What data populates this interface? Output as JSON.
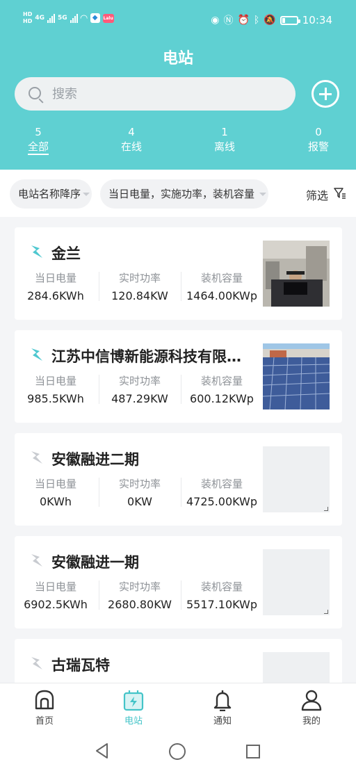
{
  "status_bar": {
    "signal_labels": [
      "HD",
      "HD",
      "4G",
      "5G"
    ],
    "app_badge": "Lalu",
    "time": "10:34"
  },
  "header": {
    "title": "电站",
    "search_placeholder": "搜索"
  },
  "stats": [
    {
      "count": "5",
      "label": "全部",
      "active": true
    },
    {
      "count": "4",
      "label": "在线"
    },
    {
      "count": "1",
      "label": "离线"
    },
    {
      "count": "0",
      "label": "报警"
    }
  ],
  "filters": {
    "sort_label": "电站名称降序",
    "fields_label": "当日电量，实施功率，装机容量",
    "filter_label": "筛选"
  },
  "card_labels": {
    "energy": "当日电量",
    "power": "实时功率",
    "capacity": "装机容量"
  },
  "plants": [
    {
      "name": "金兰",
      "energy": "284.6KWh",
      "power": "120.84KW",
      "capacity": "1464.00KWp",
      "status": "online",
      "image": "office-person-photo"
    },
    {
      "name": "江苏中信博新能源科技有限…",
      "energy": "985.5KWh",
      "power": "487.29KW",
      "capacity": "600.12KWp",
      "status": "online",
      "image": "solar-panel-roof-photo"
    },
    {
      "name": "安徽融进二期",
      "energy": "0KWh",
      "power": "0KW",
      "capacity": "4725.00KWp",
      "status": "offline",
      "image": "placeholder"
    },
    {
      "name": "安徽融进一期",
      "energy": "6902.5KWh",
      "power": "2680.80KW",
      "capacity": "5517.10KWp",
      "status": "offline",
      "image": "placeholder"
    },
    {
      "name": "古瑞瓦特",
      "status": "offline",
      "image": "placeholder"
    }
  ],
  "tabs": [
    {
      "label": "首页",
      "icon": "home-icon"
    },
    {
      "label": "电站",
      "icon": "power-station-icon",
      "active": true
    },
    {
      "label": "通知",
      "icon": "bell-icon"
    },
    {
      "label": "我的",
      "icon": "user-icon"
    }
  ],
  "colors": {
    "accent": "#5fd0d2",
    "active_tab": "#44c4c8",
    "online_icon": "#4fc8d0",
    "offline_icon": "#c8cbd0"
  }
}
